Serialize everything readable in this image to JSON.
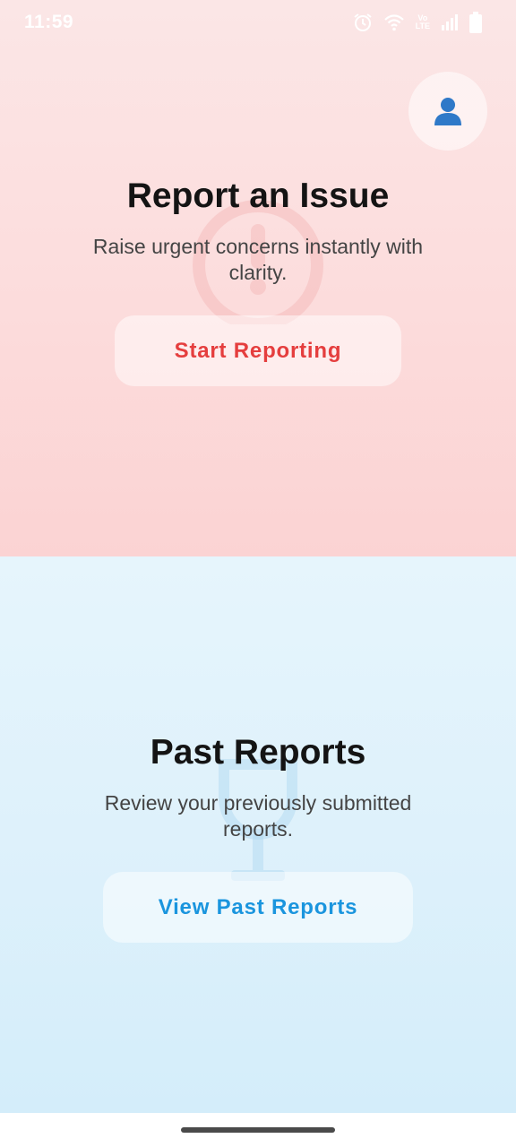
{
  "status_bar": {
    "time": "11:59",
    "network_label_top": "Vo",
    "network_label_bottom": "LTE"
  },
  "profile": {
    "icon": "person-icon",
    "icon_color": "#2f79c8"
  },
  "report": {
    "title": "Report an Issue",
    "subtitle": "Raise urgent concerns instantly with clarity.",
    "button_label": "Start Reporting",
    "accent_color": "#e53e3e",
    "watermark_icon": "alert-circle-icon"
  },
  "past": {
    "title": "Past Reports",
    "subtitle": "Review your previously submitted reports.",
    "button_label": "View Past Reports",
    "accent_color": "#1a95de",
    "watermark_icon": "trophy-icon"
  }
}
